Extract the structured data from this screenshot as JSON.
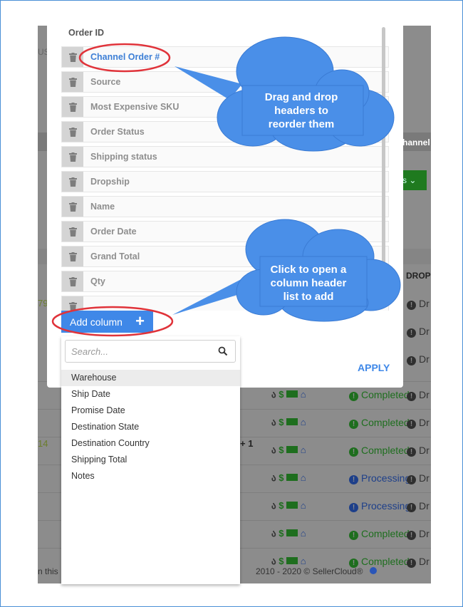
{
  "modal": {
    "top_header": "Order ID",
    "columns": [
      "Channel Order #",
      "Source",
      "Most Expensive SKU",
      "Order Status",
      "Shipping status",
      "Dropship",
      "Name",
      "Order Date",
      "Grand Total",
      "Qty"
    ],
    "add_column_label": "Add column",
    "add_icon": "+",
    "apply_label": "APPLY"
  },
  "dropdown": {
    "search_placeholder": "Search...",
    "options": [
      "Warehouse",
      "Ship Date",
      "Promise Date",
      "Destination State",
      "Destination Country",
      "Shipping Total",
      "Notes"
    ]
  },
  "callouts": {
    "drag_lines": [
      "Drag and drop",
      "headers to",
      "reorder them"
    ],
    "click_lines": [
      "Click to open a",
      "column header",
      "list to add"
    ]
  },
  "background": {
    "left_fragments": [
      "US",
      "79",
      "14"
    ],
    "right_fragments": [
      "hannel",
      "s",
      "DROP"
    ],
    "mid_fragment": "+ 1",
    "row_statuses": [
      {
        "status": "Completed",
        "color": "green",
        "dr": "Dr"
      },
      {
        "status": "Completed",
        "color": "green",
        "dr": "Dr"
      },
      {
        "status": "Completed",
        "color": "green",
        "dr": "Dr"
      },
      {
        "status": "Processing",
        "color": "blue",
        "dr": "Dr"
      },
      {
        "status": "Processing",
        "color": "blue",
        "dr": "Dr"
      },
      {
        "status": "Completed",
        "color": "green",
        "dr": "Dr"
      },
      {
        "status": "Completed",
        "color": "green",
        "dr": "Dr"
      }
    ],
    "extra_dr": [
      "Dr",
      "Dr",
      "Dr"
    ],
    "footer_left": "n this",
    "footer_mid": "2010 - 2020 © SellerCloud®"
  },
  "colors": {
    "accent": "#3f88e8",
    "link": "#3d7fd6",
    "callout": "#4a8fe8",
    "highlight_ring": "#e0333a"
  }
}
